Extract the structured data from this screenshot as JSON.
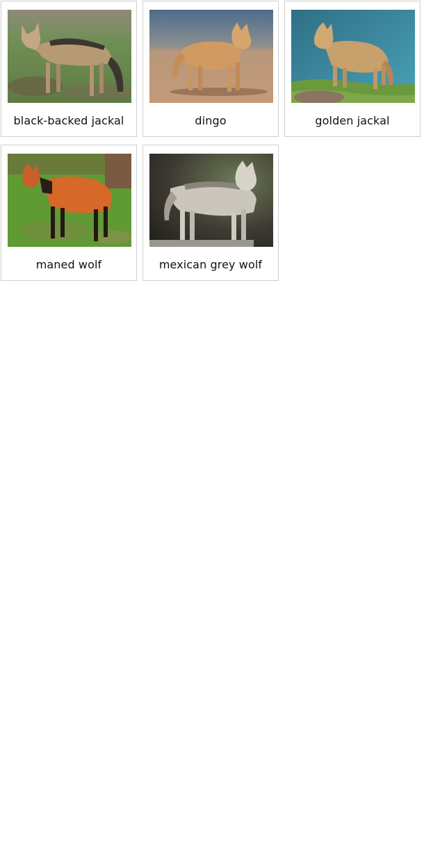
{
  "cards": [
    {
      "label": "black-backed jackal",
      "image": "black-backed-jackal-photo"
    },
    {
      "label": "dingo",
      "image": "dingo-photo"
    },
    {
      "label": "golden jackal",
      "image": "golden-jackal-photo"
    },
    {
      "label": "maned wolf",
      "image": "maned-wolf-photo"
    },
    {
      "label": "mexican grey wolf",
      "image": "mexican-grey-wolf-photo"
    }
  ]
}
